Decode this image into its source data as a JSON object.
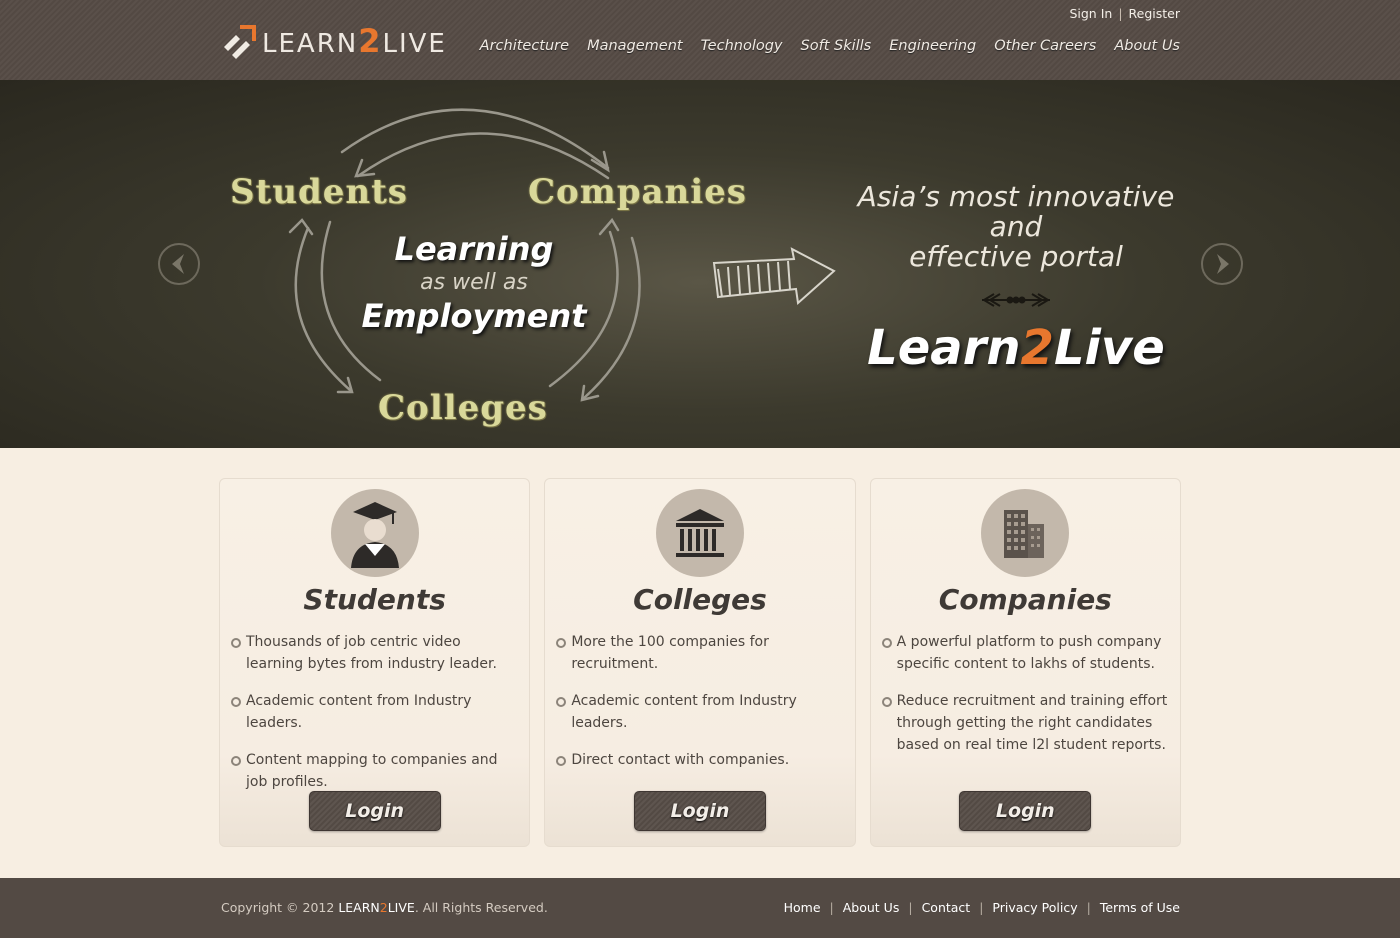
{
  "header": {
    "logo": {
      "prefix": "LEARN",
      "two": "2",
      "suffix": "LIVE"
    },
    "auth": {
      "sign_in": "Sign In",
      "separator": "|",
      "register": "Register"
    },
    "nav": [
      "Architecture",
      "Management",
      "Technology",
      "Soft Skills",
      "Engineering",
      "Other Careers",
      "About Us"
    ]
  },
  "hero": {
    "cycle": {
      "students": "Students",
      "companies": "Companies",
      "colleges": "Colleges"
    },
    "center": {
      "learning": "Learning",
      "as_well_as": "as well as",
      "employment": "Employment"
    },
    "tagline": {
      "line1": "Asia’s most innovative",
      "line2": "and",
      "line3": "effective portal"
    },
    "brand": {
      "prefix": "Learn",
      "two": "2",
      "suffix": "Live"
    }
  },
  "cards": [
    {
      "icon": "graduate-icon",
      "title": "Students",
      "items": [
        "Thousands of job centric video learning bytes from industry leader.",
        "Academic content from Industry leaders.",
        "Content mapping to companies and job profiles."
      ],
      "button": "Login"
    },
    {
      "icon": "college-building-icon",
      "title": "Colleges",
      "items": [
        "More the 100 companies for recruitment.",
        "Academic content from Industry leaders.",
        "Direct contact with companies."
      ],
      "button": "Login"
    },
    {
      "icon": "office-buildings-icon",
      "title": "Companies",
      "items": [
        "A powerful platform to push company specific content to lakhs of students.",
        "Reduce recruitment and training effort through getting the right candidates based on real time l2l student reports."
      ],
      "button": "Login"
    }
  ],
  "footer": {
    "copyright_prefix": "Copyright © 2012 ",
    "brand": {
      "prefix": "LEARN",
      "two": "2",
      "suffix": "LIVE"
    },
    "copyright_suffix": ". All Rights Reserved.",
    "links": [
      "Home",
      "About Us",
      "Contact",
      "Privacy Policy",
      "Terms of Use"
    ],
    "separator": "|"
  },
  "colors": {
    "accent": "#e8772e",
    "header_bg": "#574d47",
    "page_bg": "#f7eee2",
    "chalk": "#d9d89a"
  }
}
